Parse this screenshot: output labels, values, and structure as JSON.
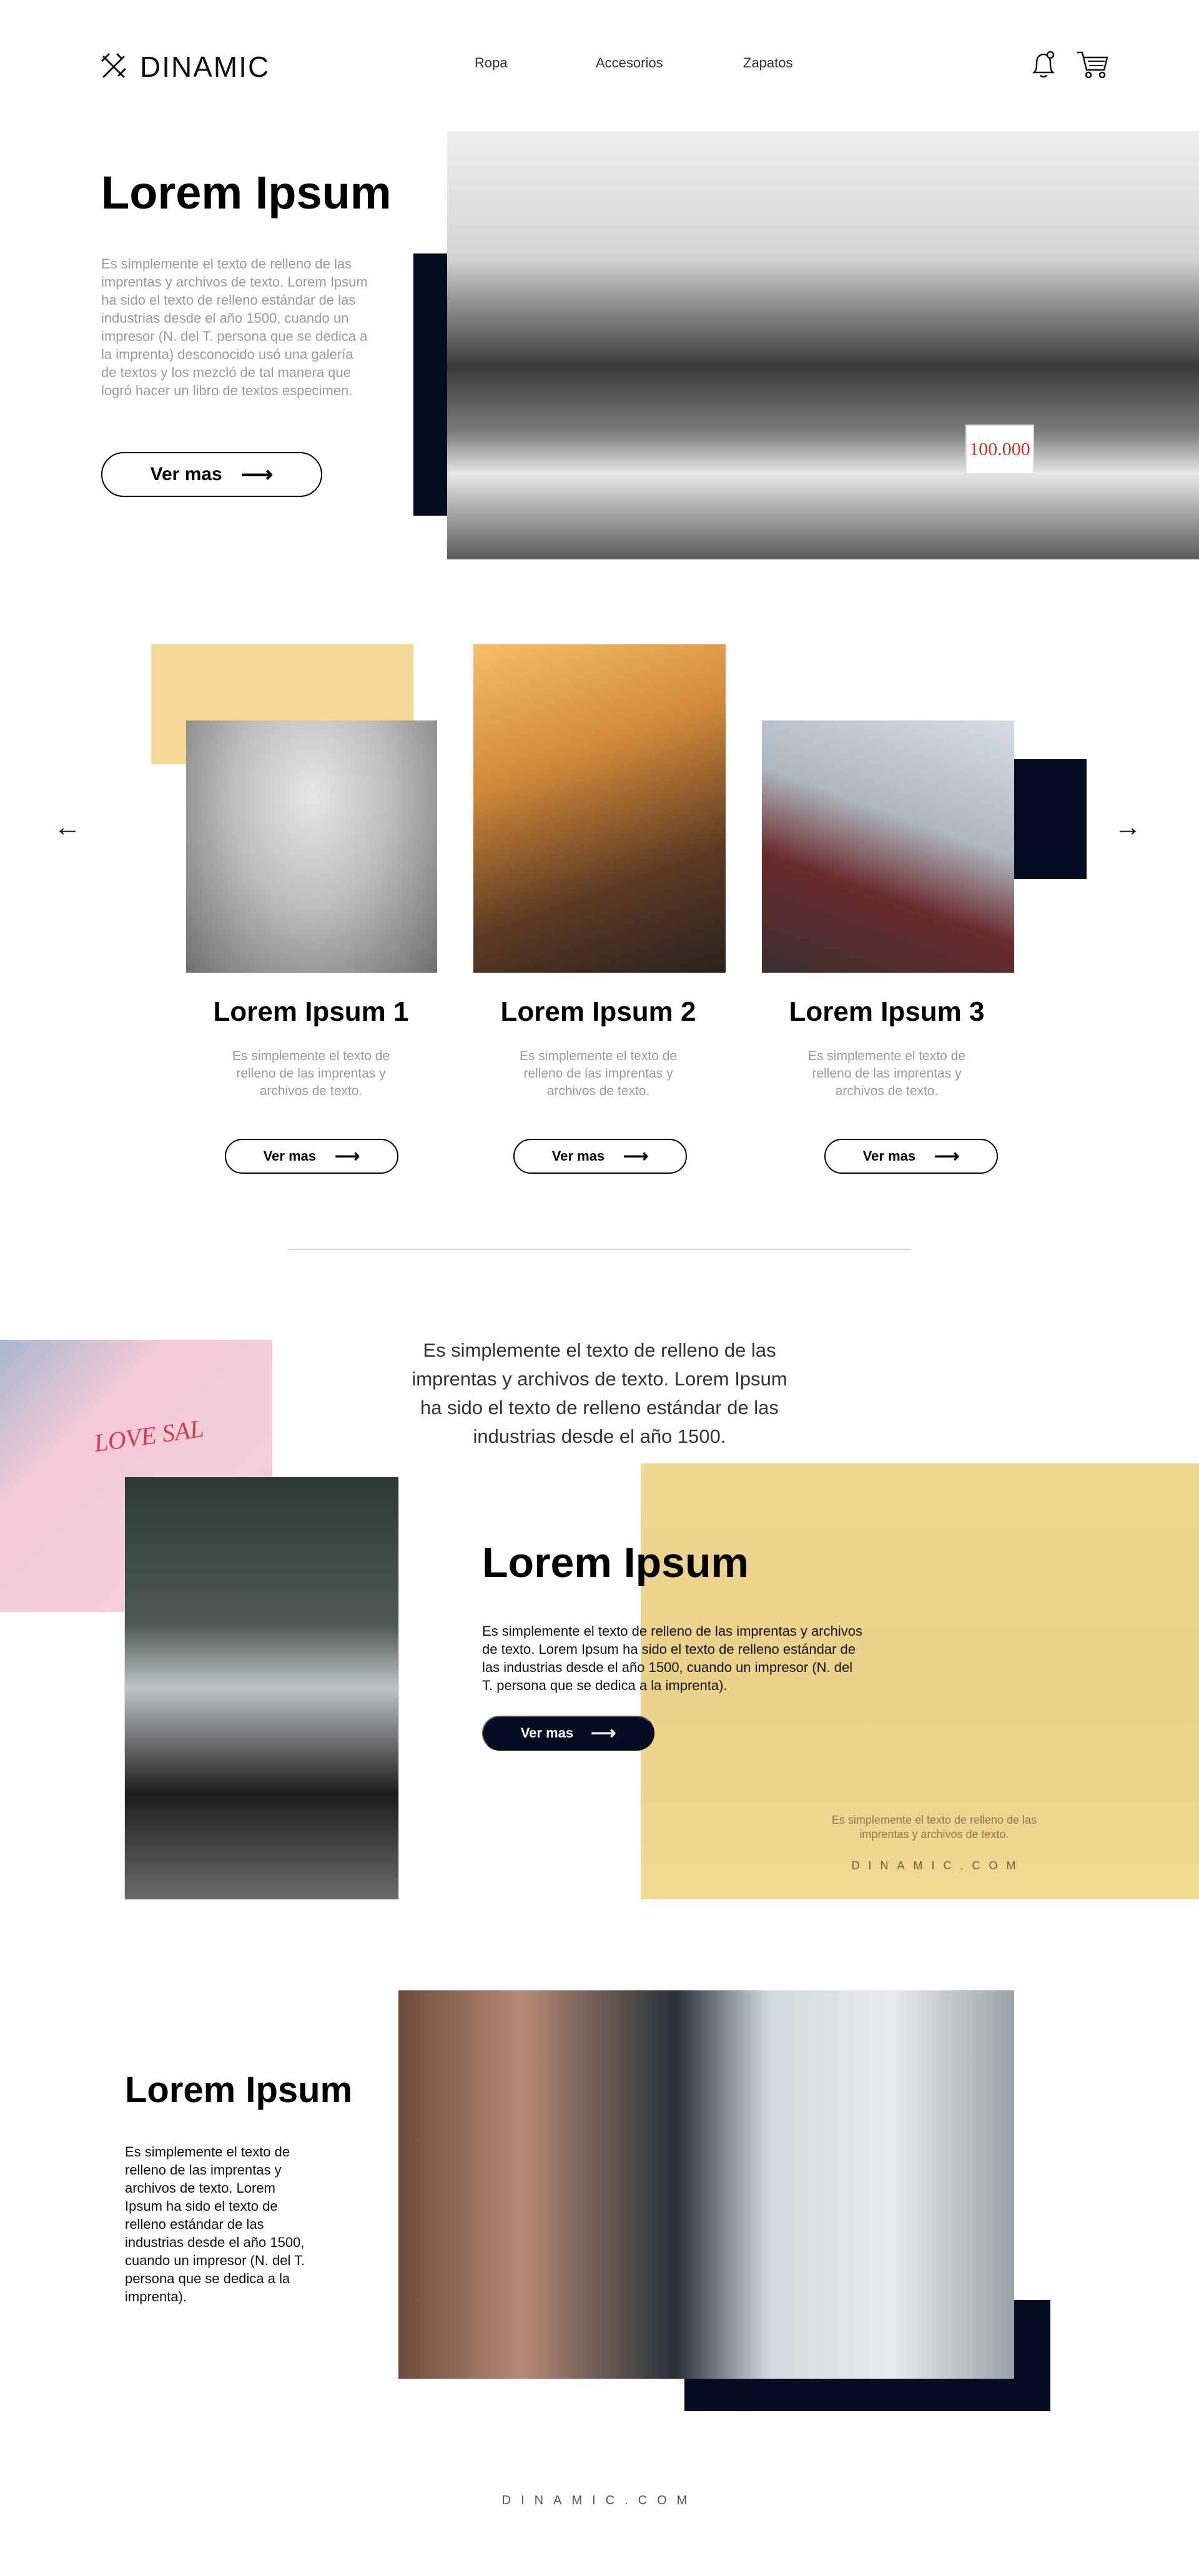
{
  "brand": {
    "name": "DINAMIC",
    "logo_icon": "crossed-tools-icon"
  },
  "nav": {
    "items": [
      "Ropa",
      "Accesorios",
      "Zapatos"
    ]
  },
  "header_icons": {
    "bell": "bell-icon",
    "cart": "cart-icon"
  },
  "hero": {
    "title": "Lorem Ipsum",
    "text": "Es simplemente el texto de relleno de las imprentas y archivos de texto. Lorem Ipsum ha sido el texto de relleno estándar de las industrias desde el año 1500, cuando un impresor (N. del T. persona que se dedica a la imprenta) desconocido usó una galería de textos y los mezcló de tal manera que logró hacer un libro de textos especimen.",
    "button": "Ver mas",
    "price_tag": "100.000"
  },
  "carousel": {
    "cards": [
      {
        "title": "Lorem Ipsum 1",
        "text": "Es simplemente el texto de relleno de las imprentas y archivos de texto.",
        "button": "Ver mas"
      },
      {
        "title": "Lorem Ipsum 2",
        "text": "Es simplemente el texto de relleno de las imprentas y archivos de texto.",
        "button": "Ver mas"
      },
      {
        "title": "Lorem Ipsum 3",
        "text": "Es simplemente el texto de relleno de las imprentas y archivos de texto.",
        "button": "Ver mas"
      }
    ]
  },
  "quote": {
    "text": "Es simplemente el texto de relleno de las imprentas y archivos de texto. Lorem Ipsum ha sido el texto de relleno estándar de las industrias desde el año 1500."
  },
  "feature": {
    "title": "Lorem Ipsum",
    "text": "Es simplemente el texto de relleno de las imprentas y archivos de texto. Lorem Ipsum ha sido el texto de relleno estándar de las industrias desde el año 1500, cuando un impresor (N. del T. persona que se dedica a la imprenta).",
    "button": "Ver mas",
    "tshirt_print": "LOVE SAL",
    "yellow_caption": "Es simplemente el texto de relleno de las imprentas y archivos de texto.",
    "yellow_domain": "DINAMIC.COM"
  },
  "bottom": {
    "title": "Lorem Ipsum",
    "text": "Es simplemente el texto de relleno de las imprentas y archivos de texto. Lorem Ipsum ha sido el texto de relleno estándar de las industrias desde el año 1500, cuando un impresor (N. del T. persona que se dedica a la imprenta)."
  },
  "footer": {
    "domain": "DINAMIC.COM"
  },
  "colors": {
    "navy": "#060c22",
    "yellow": "#f3d896",
    "gray_text": "#9a9a9a"
  }
}
